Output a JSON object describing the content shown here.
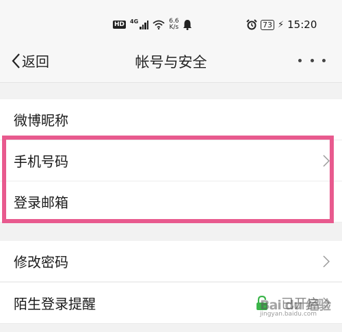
{
  "status_bar": {
    "hd_badge": "HD",
    "network_type": "4G",
    "net_speed_value": "6.6",
    "net_speed_unit": "K/s",
    "battery_level": "73",
    "time": "15:20"
  },
  "nav": {
    "back_label": "返回",
    "title": "帐号与安全"
  },
  "rows": {
    "weibo_nickname": "微博昵称",
    "phone_number": "手机号码",
    "login_email": "登录邮箱",
    "change_password": "修改密码",
    "stranger_login_alert": "陌生登录提醒",
    "stranger_login_status": "已开启"
  },
  "watermark": {
    "logo": "Bai du 经验",
    "url": "jingyan.baidu.com"
  }
}
